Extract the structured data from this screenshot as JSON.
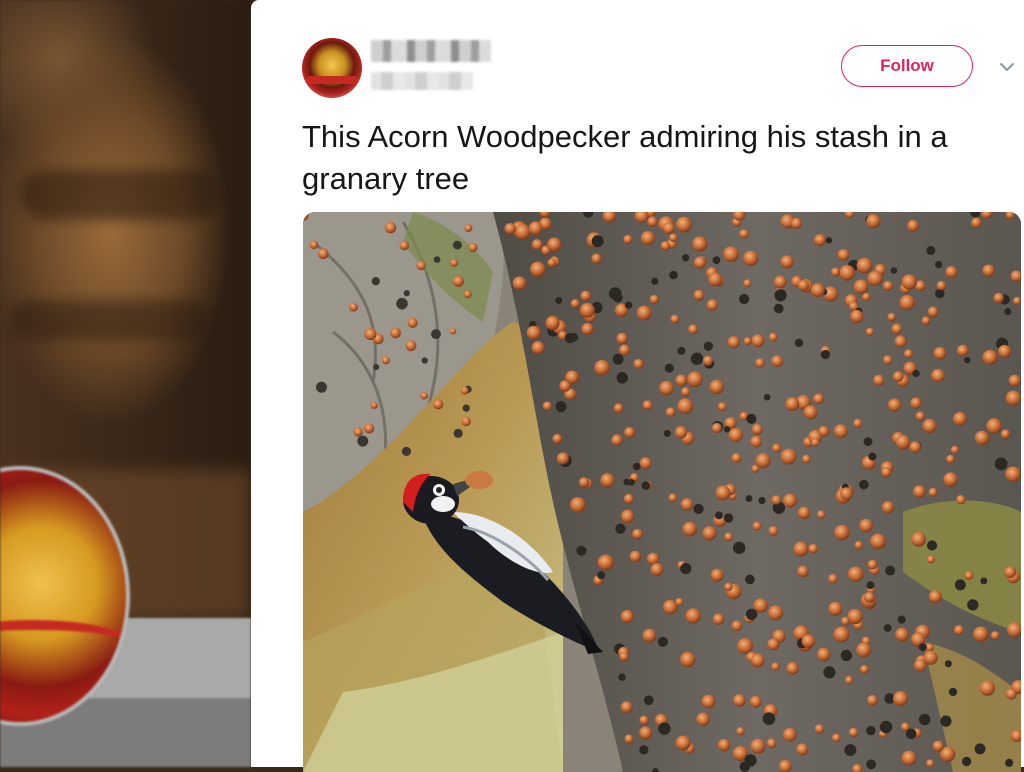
{
  "tweet": {
    "text": "This Acorn Woodpecker admiring his stash in a granary tree",
    "follow_label": "Follow",
    "more_icon": "chevron-down-icon",
    "accent_color": "#e0245e",
    "text_color": "#14171a"
  },
  "icons": {
    "more": "chevron-down-icon",
    "avatar": "avatar"
  }
}
